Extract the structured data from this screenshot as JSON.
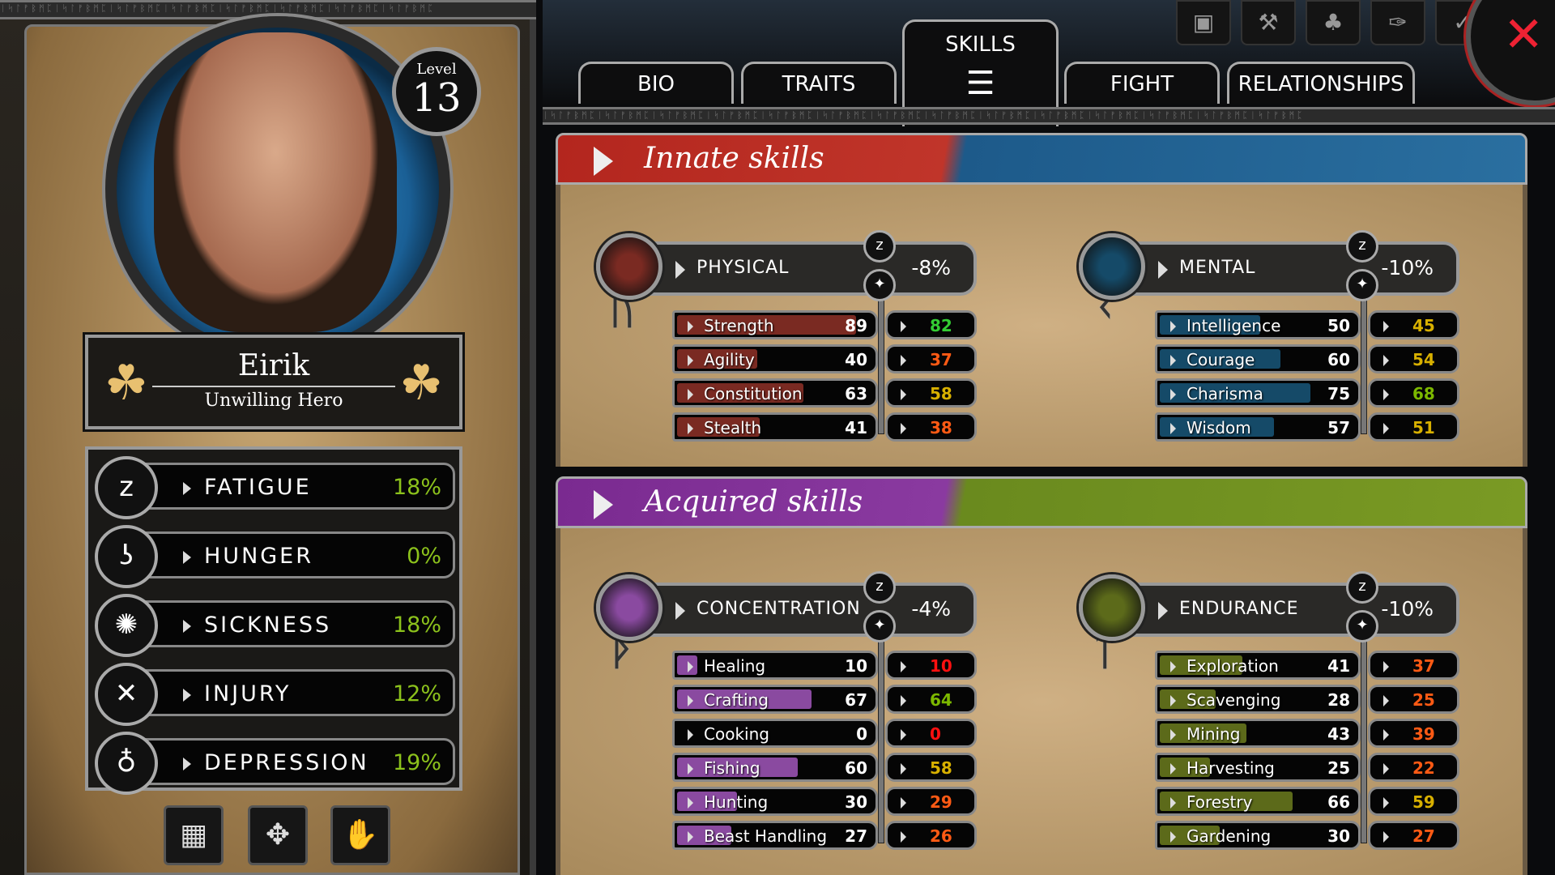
{
  "character": {
    "name": "Eirik",
    "title": "Unwilling Hero",
    "level_label": "Level",
    "level": "13"
  },
  "status": [
    {
      "label": "FATIGUE",
      "value": "18%",
      "icon": "zzz-icon",
      "glyph": "z"
    },
    {
      "label": "HUNGER",
      "value": "0%",
      "icon": "stomach-icon",
      "glyph": "ʖ"
    },
    {
      "label": "SICKNESS",
      "value": "18%",
      "icon": "virus-icon",
      "glyph": "✺"
    },
    {
      "label": "INJURY",
      "value": "12%",
      "icon": "bone-icon",
      "glyph": "✕"
    },
    {
      "label": "DEPRESSION",
      "value": "19%",
      "icon": "droplet-icon",
      "glyph": "♁"
    }
  ],
  "bottom_buttons": [
    {
      "icon": "map-icon",
      "glyph": "▦"
    },
    {
      "icon": "move-arrows-icon",
      "glyph": "✥"
    },
    {
      "icon": "hand-icon",
      "glyph": "✋"
    }
  ],
  "tabs": [
    {
      "label": "BIO"
    },
    {
      "label": "TRAITS"
    },
    {
      "label": "SKILLS",
      "active": true
    },
    {
      "label": "FIGHT"
    },
    {
      "label": "RELATIONSHIPS"
    }
  ],
  "top_icons": [
    {
      "icon": "chest-icon",
      "glyph": "▣"
    },
    {
      "icon": "hammer-icon",
      "glyph": "⚒"
    },
    {
      "icon": "tree-icon",
      "glyph": "♣"
    },
    {
      "icon": "map-compass-icon",
      "glyph": "✑"
    },
    {
      "icon": "checklist-icon",
      "glyph": "✓"
    }
  ],
  "colors": {
    "physical": "#7a2a22",
    "mental": "#154a68",
    "concentration": "#8a4aa0",
    "endurance": "#5c6a1a",
    "green": "#33cc33",
    "olive": "#7cb800",
    "yellow": "#d8b000",
    "orange": "#ff5a14",
    "red": "#ff1010"
  },
  "innate": {
    "title": "Innate skills",
    "groups": [
      {
        "key": "physical",
        "label": "PHYSICAL",
        "modifier": "-8%",
        "rune": "ᚢ",
        "stats": [
          {
            "name": "Strength",
            "value": 89,
            "effective": 82,
            "color": "green"
          },
          {
            "name": "Agility",
            "value": 40,
            "effective": 37,
            "color": "orange"
          },
          {
            "name": "Constitution",
            "value": 63,
            "effective": 58,
            "color": "yellow"
          },
          {
            "name": "Stealth",
            "value": 41,
            "effective": 38,
            "color": "orange"
          }
        ]
      },
      {
        "key": "mental",
        "label": "MENTAL",
        "modifier": "-10%",
        "rune": "ᚲ",
        "stats": [
          {
            "name": "Intelligence",
            "value": 50,
            "effective": 45,
            "color": "yellow"
          },
          {
            "name": "Courage",
            "value": 60,
            "effective": 54,
            "color": "yellow"
          },
          {
            "name": "Charisma",
            "value": 75,
            "effective": 68,
            "color": "olive"
          },
          {
            "name": "Wisdom",
            "value": 57,
            "effective": 51,
            "color": "yellow"
          }
        ]
      }
    ]
  },
  "acquired": {
    "title": "Acquired skills",
    "groups": [
      {
        "key": "concentration",
        "label": "CONCENTRATION",
        "modifier": "-4%",
        "rune": "ᚦ",
        "stats": [
          {
            "name": "Healing",
            "value": 10,
            "effective": 10,
            "color": "red"
          },
          {
            "name": "Crafting",
            "value": 67,
            "effective": 64,
            "color": "olive"
          },
          {
            "name": "Cooking",
            "value": 0,
            "effective": 0,
            "color": "red"
          },
          {
            "name": "Fishing",
            "value": 60,
            "effective": 58,
            "color": "yellow"
          },
          {
            "name": "Hunting",
            "value": 30,
            "effective": 29,
            "color": "orange"
          },
          {
            "name": "Beast Handling",
            "value": 27,
            "effective": 26,
            "color": "orange"
          }
        ]
      },
      {
        "key": "endurance",
        "label": "ENDURANCE",
        "modifier": "-10%",
        "rune": "ᛏ",
        "stats": [
          {
            "name": "Exploration",
            "value": 41,
            "effective": 37,
            "color": "orange"
          },
          {
            "name": "Scavenging",
            "value": 28,
            "effective": 25,
            "color": "orange"
          },
          {
            "name": "Mining",
            "value": 43,
            "effective": 39,
            "color": "orange"
          },
          {
            "name": "Harvesting",
            "value": 25,
            "effective": 22,
            "color": "orange"
          },
          {
            "name": "Forestry",
            "value": 66,
            "effective": 59,
            "color": "yellow"
          },
          {
            "name": "Gardening",
            "value": 30,
            "effective": 27,
            "color": "orange"
          }
        ]
      }
    ]
  }
}
